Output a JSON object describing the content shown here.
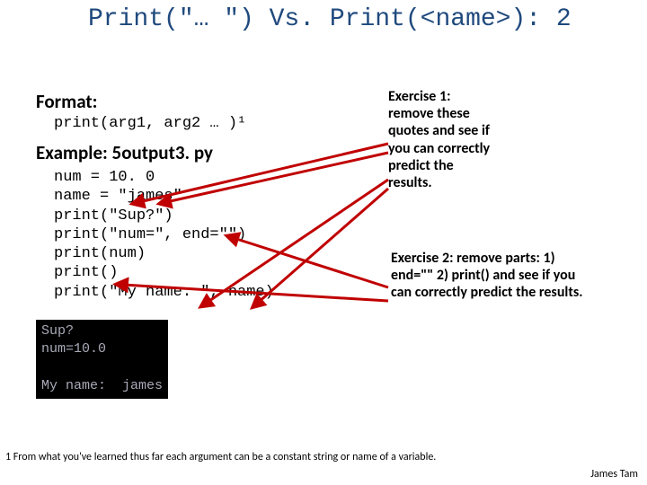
{
  "title": "Print(\"… \") Vs. Print(<name>): 2",
  "headings": {
    "format": "Format:",
    "example": "Example: 5output3. py"
  },
  "format_line": "print(arg1, arg2 … )¹",
  "code_lines": [
    "num = 10. 0",
    "name = \"james\"",
    "print(\"Sup?\")",
    "print(\"num=\", end=\"\")",
    "print(num)",
    "print()",
    "print(\"My name: \", name)"
  ],
  "output_lines": [
    "Sup?",
    "num=10.0",
    "",
    "My name:  james"
  ],
  "exercise1": "Exercise 1: remove these quotes and see if you can correctly predict the results.",
  "exercise2": "Exercise 2: remove parts: 1) end=\"\"   2) print() and see if you can correctly predict the results.",
  "footnote": "1 From what you've learned thus far each argument can be a constant string or name of a variable.",
  "author": "James Tam",
  "colors": {
    "title": "#1f497d",
    "arrow": "#c00000"
  }
}
